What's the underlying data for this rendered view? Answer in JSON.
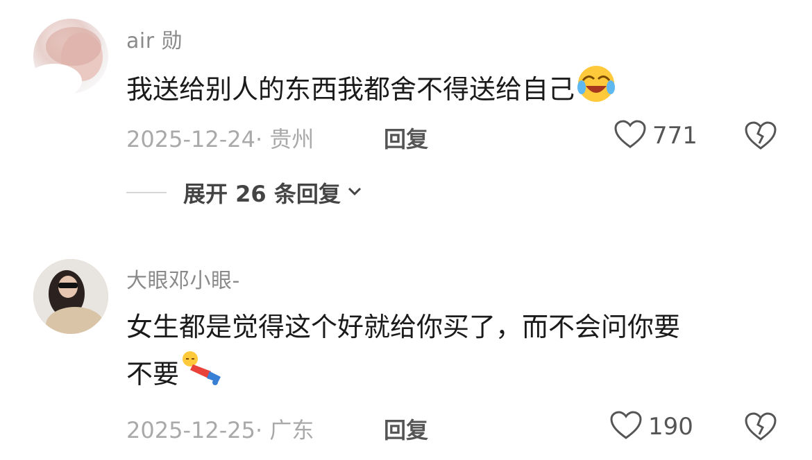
{
  "comments": [
    {
      "username": "air 勋",
      "text": "我送给别人的东西我都舍不得送给自己",
      "text_line2": "",
      "emoji": "laughing-crying-emoji",
      "date_location": "2025-12-24· 贵州",
      "reply_label": "回复",
      "likes": "771",
      "expand_label": "展开 26 条回复"
    },
    {
      "username": "大眼邓小眼-",
      "text": "女生都是觉得这个好就给你买了，而不会问你要",
      "text_line2": "不要",
      "emoji": "lying-down-emoji",
      "date_location": "2025-12-25· 广东",
      "reply_label": "回复",
      "likes": "190"
    }
  ],
  "icons": {
    "like": "heart-outline-icon",
    "dislike": "broken-heart-icon",
    "expand": "chevron-down-icon"
  },
  "colors": {
    "username": "#8a8a8a",
    "meta": "#a9a9a9",
    "text": "#1a1a1a"
  }
}
